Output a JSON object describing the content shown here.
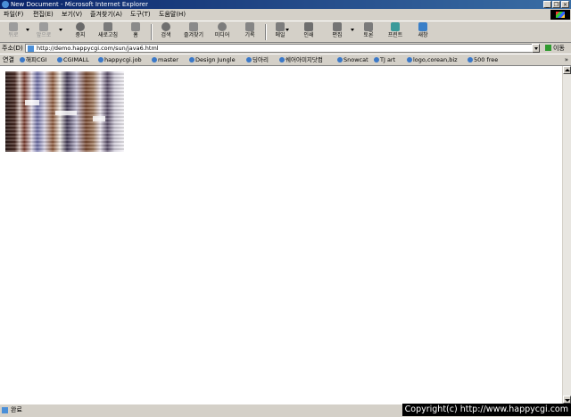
{
  "window": {
    "title": "New Document - Microsoft Internet Explorer",
    "buttons": [
      "_",
      "❐",
      "×"
    ]
  },
  "menu": {
    "items": [
      "파일(F)",
      "편집(E)",
      "보기(V)",
      "즐겨찾기(A)",
      "도구(T)",
      "도움말(H)"
    ]
  },
  "toolbar": {
    "back": "뒤로",
    "forward": "앞으로",
    "stop": "중지",
    "refresh": "새로고침",
    "home": "홈",
    "search": "검색",
    "favorites": "즐겨찾기",
    "media": "미디어",
    "history": "기록",
    "mail": "메일",
    "print": "인쇄",
    "edit": "편집",
    "discuss": "토론",
    "printer": "프린트",
    "messenger": "새창"
  },
  "address": {
    "label": "주소(D)",
    "url": "http://demo.happycgi.com/sun/java6.html",
    "go": "이동"
  },
  "links": {
    "label": "연결",
    "items": [
      "해피CGI",
      "CGIMALL",
      "happycgi.job",
      "master",
      "Design Jungle",
      "딩아리",
      "쉐어아미지닷컴",
      "Snowcat",
      "TJ art",
      "logo,corean,biz",
      "500 free"
    ],
    "more": "»"
  },
  "status": {
    "text": "완료"
  },
  "copyright": "Copyright(c) http://www.happycgi.com"
}
